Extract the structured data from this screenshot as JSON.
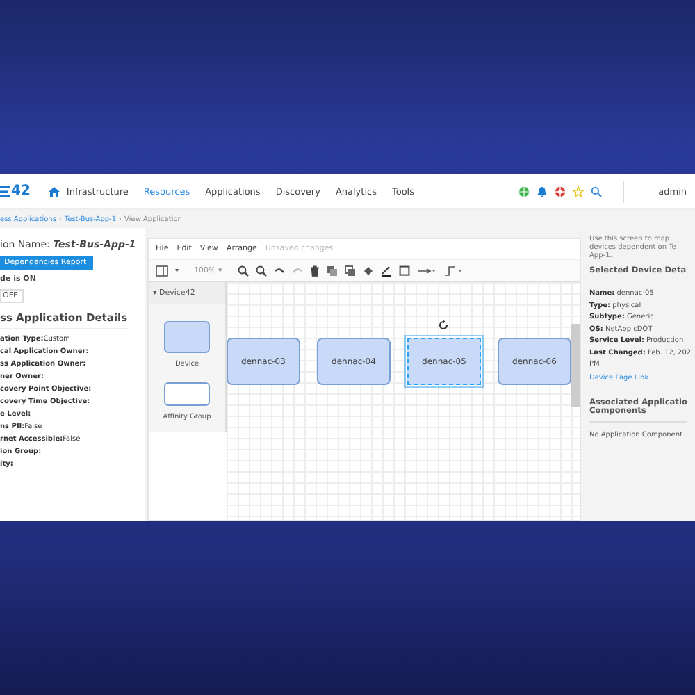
{
  "header": {
    "logo": "42",
    "nav": [
      {
        "label": "Infrastructure",
        "selected": false
      },
      {
        "label": "Resources",
        "selected": true
      },
      {
        "label": "Applications",
        "selected": false
      },
      {
        "label": "Discovery",
        "selected": false
      },
      {
        "label": "Analytics",
        "selected": false
      },
      {
        "label": "Tools",
        "selected": false
      }
    ],
    "user": "admin"
  },
  "breadcrumb": [
    "ess Applications",
    "Test-Bus-App-1",
    "View Application"
  ],
  "breadcrumb_separator": "›",
  "left_panel": {
    "name_label": "ion Name:",
    "name_value": "Test-Bus-App-1",
    "report_button": "Dependencies Report",
    "mode_text": "de is ON",
    "toggle_button": "OFF",
    "details_title": "ss Application Details",
    "fields": [
      {
        "label": "ation Type:",
        "value": "Custom"
      },
      {
        "label": "cal Application Owner:"
      },
      {
        "label": "ss Application Owner:"
      },
      {
        "label": "ner Owner:"
      },
      {
        "label": "covery Point Objective:"
      },
      {
        "label": "covery Time Objective:"
      },
      {
        "label": "e Level:"
      },
      {
        "label": "ns PII:",
        "value": "False"
      },
      {
        "label": "rnet Accessible:",
        "value": "False"
      },
      {
        "label": "ion Group:"
      },
      {
        "label": "ity:"
      }
    ]
  },
  "editor": {
    "menu": [
      "File",
      "Edit",
      "View",
      "Arrange"
    ],
    "status": "Unsaved changes",
    "zoom": "100% ▾",
    "layout_caret": "▾",
    "palette_title": "▾ Device42",
    "shapes": [
      {
        "kind": "device",
        "label": "Device"
      },
      {
        "kind": "group",
        "label": "Affinity Group"
      }
    ],
    "nodes": [
      {
        "label": "dennac-03",
        "selected": false
      },
      {
        "label": "dennac-04",
        "selected": false
      },
      {
        "label": "dennac-05",
        "selected": true
      },
      {
        "label": "dennac-06",
        "selected": false
      }
    ]
  },
  "right_panel": {
    "info_lines": [
      "Use this screen to map",
      "devices dependent on Te",
      "App-1."
    ],
    "device_title": "Selected Device Deta",
    "fields": [
      {
        "label": "Name:",
        "value": "dennac-05"
      },
      {
        "label": "Type:",
        "value": "physical"
      },
      {
        "label": "Subtype:",
        "value": "Generic"
      },
      {
        "label": "OS:",
        "value": "NetApp cDOT"
      },
      {
        "label": "Service Level:",
        "value": "Production"
      },
      {
        "label": "Last Changed:",
        "value": "Feb. 12, 202"
      }
    ],
    "changed_extra": "PM",
    "link": "Device Page Link",
    "components_title_lines": [
      "Associated Applicatio",
      "Components"
    ],
    "components_empty": "No Application Component"
  }
}
